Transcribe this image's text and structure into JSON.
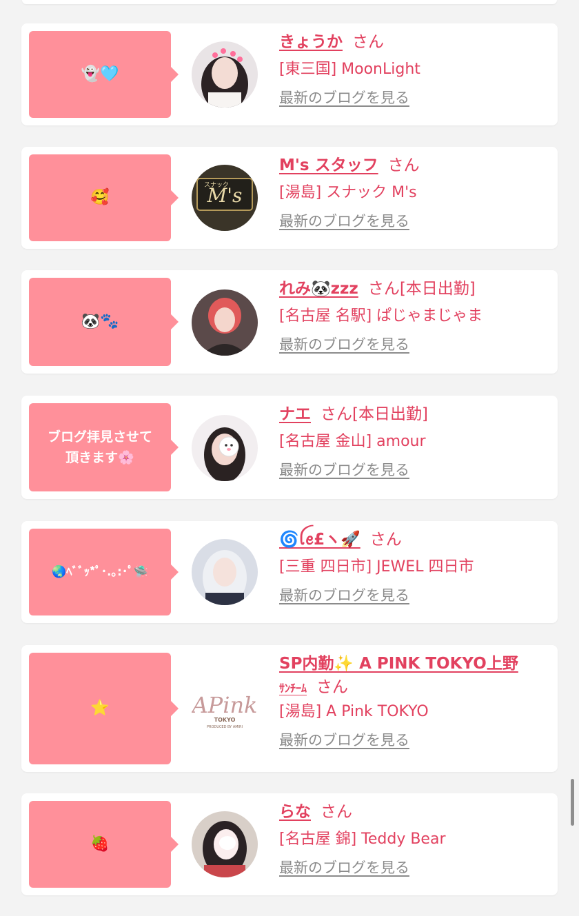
{
  "colors": {
    "accent": "#e2415f",
    "bubble": "#ff909a",
    "link_gray": "#8b8b8b",
    "background": "#f3f3f3"
  },
  "san_label": "さん",
  "blog_link_label": "最新のブログを見る",
  "cards": [
    {
      "comment": "👻🩵",
      "name": "きょうか",
      "work_label": "",
      "shop": "[東三国] MoonLight",
      "avatar": "photo-girl-icon"
    },
    {
      "comment": "🥰",
      "name": "M's スタッフ",
      "work_label": "",
      "shop": "[湯島] スナック M's",
      "avatar": "shop-sign-icon"
    },
    {
      "comment": "🐼🐾",
      "name": "れみ🐼zzz",
      "work_label": "[本日出勤]",
      "shop": "[名古屋 名駅] ぱじゃまじゃま",
      "avatar": "photo-girl-icon"
    },
    {
      "comment": "ブログ拝見させて\n頂きます🌸",
      "name": "ナエ",
      "work_label": "[本日出勤]",
      "shop": "[名古屋 金山] amour",
      "avatar": "photo-girl-icon"
    },
    {
      "comment": "🌏ﾍﾞﾞｯ*ﾟ･.｡:･ﾟ🛸",
      "name": "🌀ꪶꫀ£ヽ🚀",
      "work_label": "",
      "shop": "[三重 四日市] JEWEL 四日市",
      "avatar": "photo-girl-icon"
    },
    {
      "comment": "⭐",
      "name": "SP内勤✨ A PINK TOKYO上野",
      "name_line2": "ｻﾝﾁｰﾑ",
      "work_label": "",
      "shop": "[湯島] A Pink TOKYO",
      "avatar": "apink-logo-icon"
    },
    {
      "comment": "🍓",
      "name": "らな",
      "work_label": "",
      "shop": "[名古屋 錦] Teddy Bear",
      "avatar": "photo-girl-icon"
    }
  ]
}
